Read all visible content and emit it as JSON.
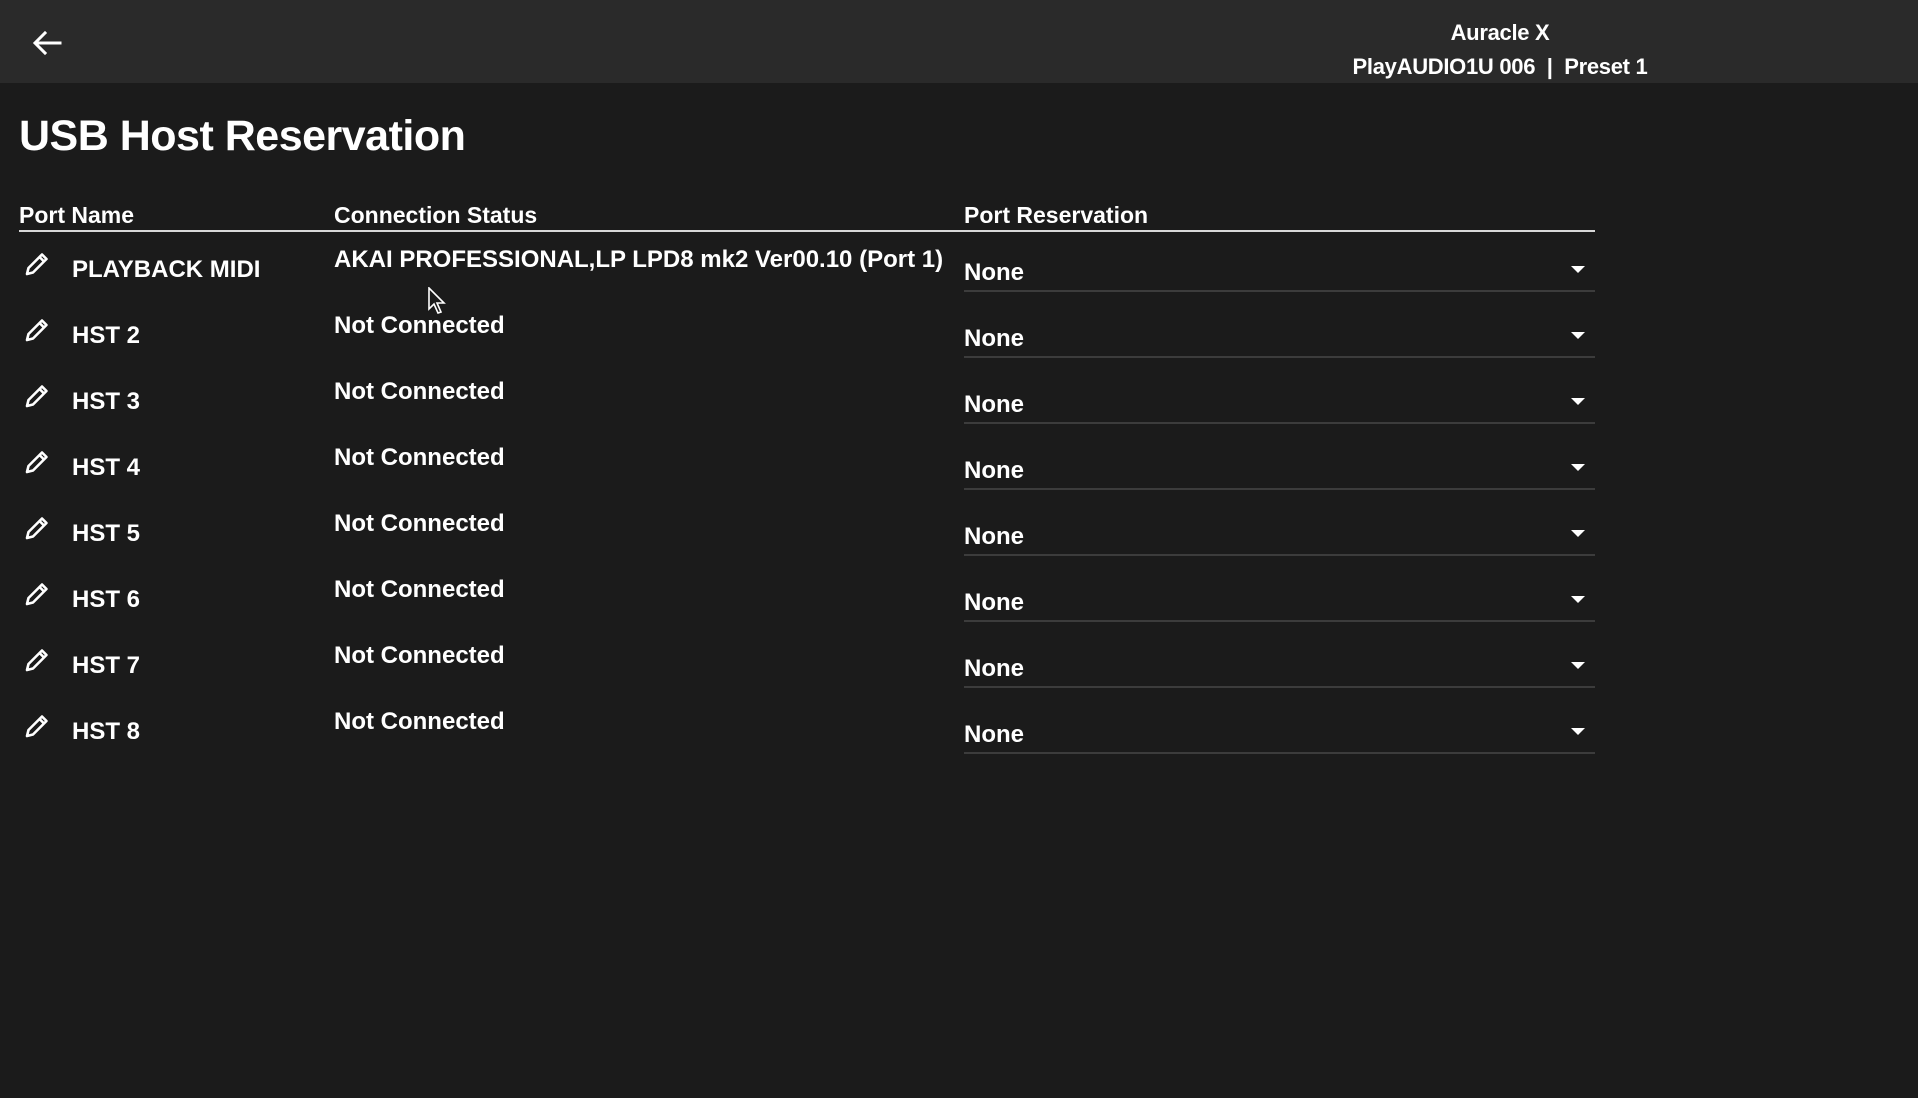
{
  "header": {
    "back_icon": "arrow-left-icon",
    "device_name": "Auracle X",
    "device_detail": "PlayAUDIO1U 006  |  Preset 1"
  },
  "page": {
    "title": "USB Host Reservation"
  },
  "table": {
    "columns": [
      "Port Name",
      "Connection Status",
      "Port Reservation"
    ],
    "rows": [
      {
        "port_name": "PLAYBACK MIDI",
        "status": "AKAI PROFESSIONAL,LP LPD8 mk2 Ver00.10 (Port 1)",
        "reservation": "None"
      },
      {
        "port_name": "HST 2",
        "status": "Not Connected",
        "reservation": "None"
      },
      {
        "port_name": "HST 3",
        "status": "Not Connected",
        "reservation": "None"
      },
      {
        "port_name": "HST 4",
        "status": "Not Connected",
        "reservation": "None"
      },
      {
        "port_name": "HST 5",
        "status": "Not Connected",
        "reservation": "None"
      },
      {
        "port_name": "HST 6",
        "status": "Not Connected",
        "reservation": "None"
      },
      {
        "port_name": "HST 7",
        "status": "Not Connected",
        "reservation": "None"
      },
      {
        "port_name": "HST 8",
        "status": "Not Connected",
        "reservation": "None"
      }
    ]
  },
  "colors": {
    "background": "#1b1b1b",
    "topbar": "#2a2a2a",
    "text": "#ffffff",
    "divider": "#d8d8d8",
    "select_underline": "#3c3c3c"
  }
}
